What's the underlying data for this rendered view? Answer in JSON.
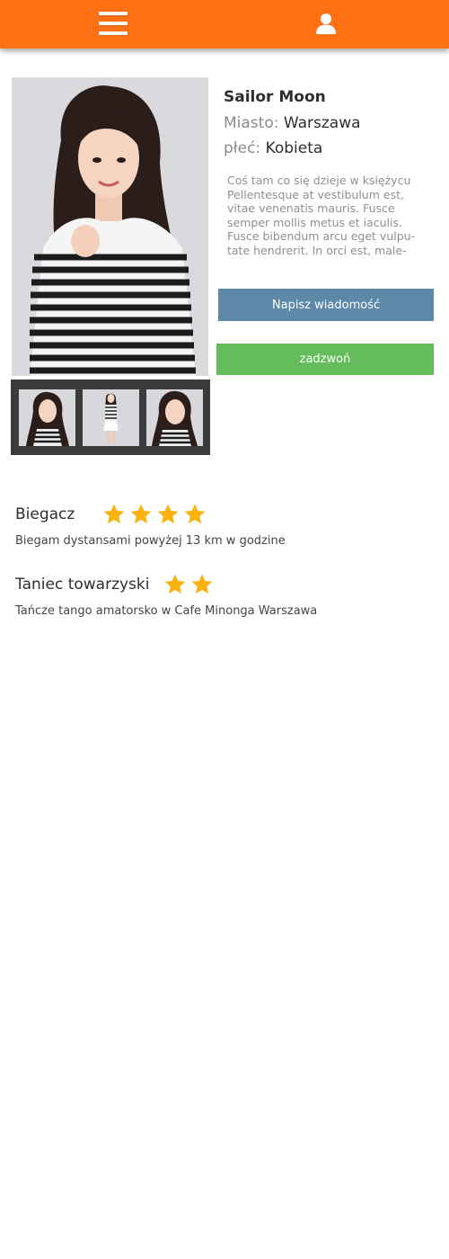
{
  "header": {
    "menu_icon": "hamburger-menu-icon",
    "user_icon": "user-icon",
    "background_color": "#fd7014"
  },
  "profile": {
    "name": "Sailor Moon",
    "city_label": "Miasto:",
    "city_value": "Warszawa",
    "gender_label": "płeć:",
    "gender_value": "Kobieta",
    "bio": "Coś tam co się dzieje w księżycu Pellentesque at vestibulum est, vitae venenatis mauris. Fusce semper mollis metus et iaculis. Fusce bibendum arcu eget vulpu-tate hendrerit. In orci est, male-"
  },
  "actions": {
    "message_label": "Napisz wiadomość",
    "message_color": "#5d88a8",
    "call_label": "zadzwoń",
    "call_color": "#64bc5a"
  },
  "skills": [
    {
      "title": "Biegacz",
      "rating": 4,
      "description": "Biegam dystansami powyżej 13 km w godzine"
    },
    {
      "title": "Taniec towarzyski",
      "rating": 2,
      "description": "Tańcze tango amatorsko w Cafe Minonga Warszawa"
    }
  ],
  "star_color": "#fbb20f"
}
